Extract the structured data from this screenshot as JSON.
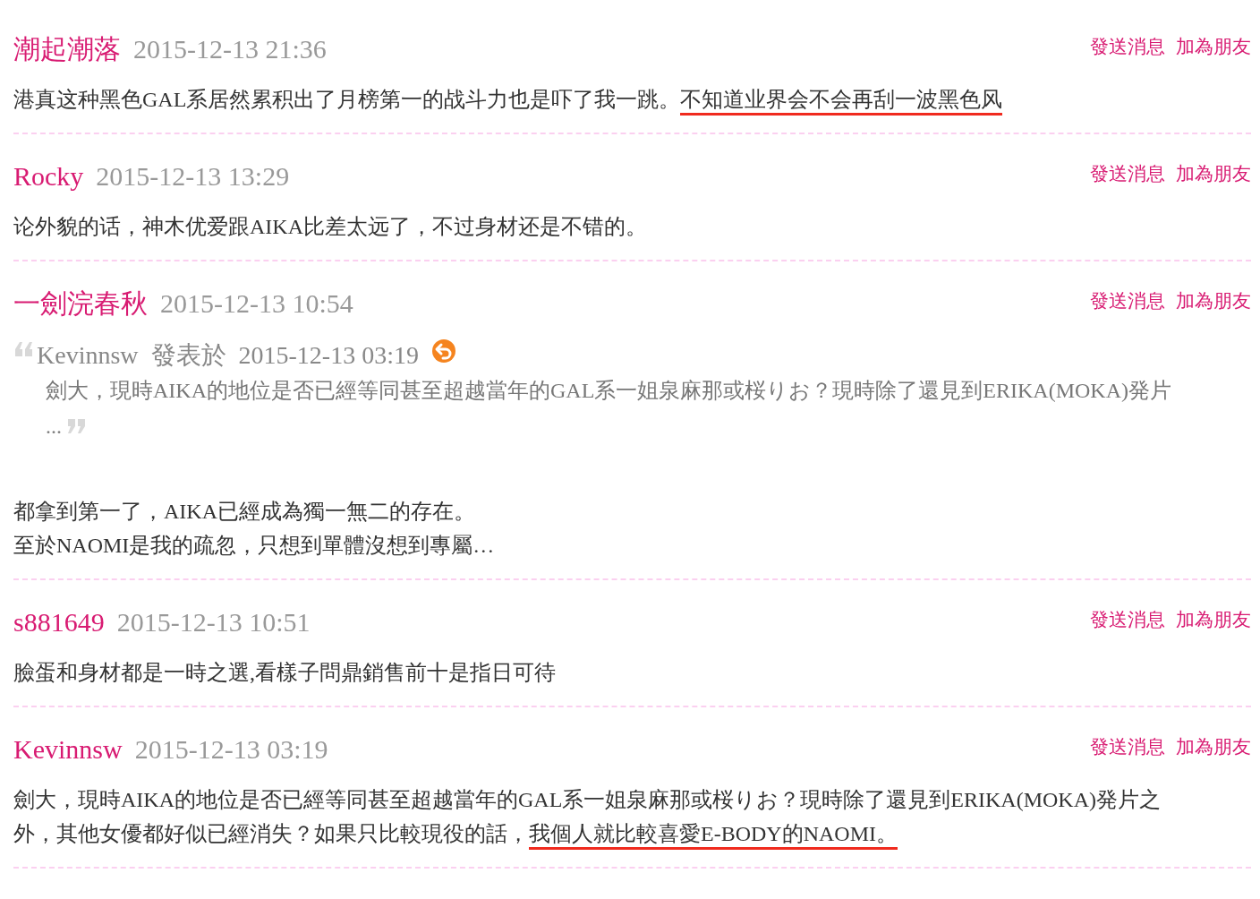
{
  "posts": [
    {
      "author": "潮起潮落",
      "datetime": "2015-12-13 21:36",
      "actions": [
        "發送消息",
        "加為朋友"
      ],
      "body": [
        {
          "segments": [
            {
              "text": "港真这种黑色GAL系居然累积出了月榜第一的战斗力也是吓了我一跳。",
              "underlined": false
            },
            {
              "text": "不知道业界会不会再刮一波黑色风",
              "underlined": true
            }
          ]
        }
      ]
    },
    {
      "author": "Rocky",
      "datetime": "2015-12-13 13:29",
      "actions": [
        "發送消息",
        "加為朋友"
      ],
      "body": [
        {
          "segments": [
            {
              "text": "论外貌的话，神木优爱跟AIKA比差太远了，不过身材还是不错的。",
              "underlined": false
            }
          ]
        }
      ]
    },
    {
      "author": "一劍浣春秋",
      "datetime": "2015-12-13 10:54",
      "actions": [
        "發送消息",
        "加為朋友"
      ],
      "quote": {
        "author": "Kevinnsw",
        "verb": "發表於",
        "datetime": "2015-12-13 03:19",
        "lines": [
          "劍大，現時AIKA的地位是否已經等同甚至超越當年的GAL系一姐泉麻那或桜りお？現時除了還見到ERIKA(MOKA)発片",
          "..."
        ]
      },
      "body": [
        {
          "segments": [
            {
              "text": "都拿到第一了，AIKA已經成為獨一無二的存在。",
              "underlined": false
            }
          ]
        },
        {
          "segments": [
            {
              "text": "至於NAOMI是我的疏忽，只想到單體沒想到專屬…",
              "underlined": false
            }
          ]
        }
      ]
    },
    {
      "author": "s881649",
      "datetime": "2015-12-13 10:51",
      "actions": [
        "發送消息",
        "加為朋友"
      ],
      "body": [
        {
          "segments": [
            {
              "text": "臉蛋和身材都是一時之選,看樣子問鼎銷售前十是指日可待",
              "underlined": false
            }
          ]
        }
      ]
    },
    {
      "author": "Kevinnsw",
      "datetime": "2015-12-13 03:19",
      "actions": [
        "發送消息",
        "加為朋友"
      ],
      "body": [
        {
          "segments": [
            {
              "text": "劍大，現時AIKA的地位是否已經等同甚至超越當年的GAL系一姐泉麻那或桜りお？現時除了還見到ERIKA(MOKA)発片之",
              "underlined": false
            }
          ]
        },
        {
          "segments": [
            {
              "text": "外，其他女優都好似已經消失？如果只比較現役的話，",
              "underlined": false
            },
            {
              "text": "我個人就比較喜愛E-BODY的NAOMI。",
              "underlined": true
            }
          ]
        }
      ]
    }
  ]
}
